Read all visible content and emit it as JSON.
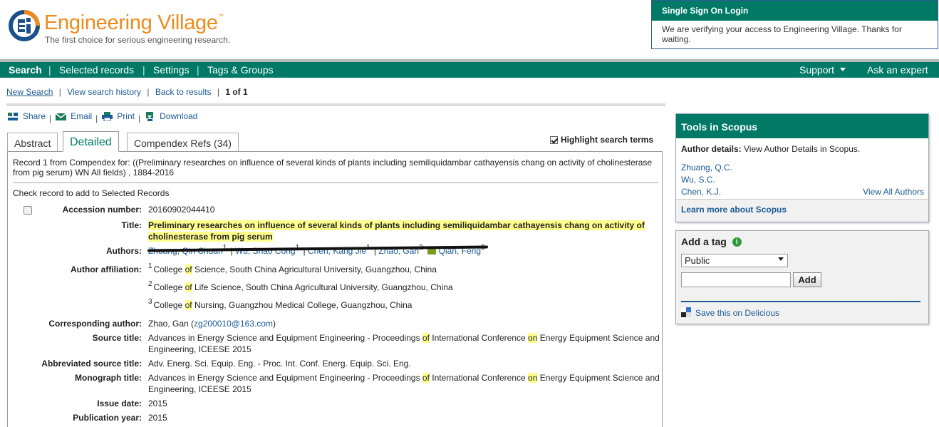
{
  "header": {
    "logo_title": "Engineering Village",
    "logo_tm": "™",
    "tagline": "The first choice for serious engineering research."
  },
  "sso": {
    "title": "Single Sign On Login",
    "message": "We are verifying your access to Engineering Village. Thanks for waiting."
  },
  "nav": {
    "search": "Search",
    "selected": "Selected records",
    "settings": "Settings",
    "tags": "Tags & Groups",
    "support": "Support",
    "ask": "Ask an expert",
    "sep": "|"
  },
  "breadcrumb": {
    "new_search": "New Search",
    "history": "View search history",
    "back": "Back to results",
    "page": "1 of 1",
    "sep": "|"
  },
  "tools": {
    "share": "Share",
    "email": "Email",
    "print": "Print",
    "download": "Download",
    "sep": "|"
  },
  "tabs": {
    "abstract": "Abstract",
    "detailed": "Detailed",
    "refs": "Compendex Refs (34)"
  },
  "highlight_label": "Highlight search terms",
  "record": {
    "from": "Record 1 from Compendex for: ((Preliminary researches on influence of several kinds of plants including semiliquidambar cathayensis chang on activity of cholinesterase from pig serum) WN All fields) , 1884-2016",
    "check_label": "Check record to add to Selected Records",
    "labels": {
      "accession": "Accession number:",
      "title": "Title:",
      "authors": "Authors:",
      "affiliation": "Author affiliation:",
      "corresponding": "Corresponding author:",
      "source": "Source title:",
      "abbrev": "Abbreviated source title:",
      "monograph": "Monograph title:",
      "issue": "Issue date:",
      "year": "Publication year:"
    },
    "accession": "20160902044410",
    "title": "Preliminary researches on influence of several kinds of plants including semiliquidambar cathayensis chang on activity of cholinesterase from pig serum",
    "authors": [
      {
        "name": "Zhuang, Qin Chuan",
        "sup": "1",
        "sep": " | "
      },
      {
        "name": "Wu, Shao Cong",
        "sup": "1",
        "sep": " | "
      },
      {
        "name": "Chen, Kang Jie",
        "sup": "1",
        "sep": " | "
      },
      {
        "name": "Zhao, Gan",
        "sup": "2",
        "sep": ""
      },
      {
        "name": "Qian, Feng",
        "sup": "3",
        "sep": ""
      }
    ],
    "of_word": "of",
    "on_word": "on",
    "affiliations": [
      {
        "num": "1",
        "pre": "College ",
        "post": " Science, South China Agricultural University, Guangzhou, China"
      },
      {
        "num": "2",
        "pre": "College ",
        "post": " Life Science, South China Agricultural University, Guangzhou, China"
      },
      {
        "num": "3",
        "pre": "College ",
        "post": " Nursing, Guangzhou Medical College, Guangzhou, China"
      }
    ],
    "corresponding_name": "Zhao, Gan (",
    "corresponding_email": "zg200010@163.com",
    "corresponding_close": ")",
    "source_a": "Advances in Energy Science and Equipment Engineering - Proceedings ",
    "source_b": " International Conference ",
    "source_c": " Energy Equipment Science and Engineering, ICEESE 2015",
    "abbrev": "Adv. Energ. Sci. Equip. Eng. - Proc. Int. Conf. Energ. Equip. Sci. Eng.",
    "issue_date": "2015",
    "pub_year": "2015"
  },
  "scopus": {
    "title": "Tools in Scopus",
    "details_label": "Author details:",
    "details_text": " View Author Details in Scopus.",
    "authors": [
      "Zhuang, Q.C.",
      "Wu, S.C.",
      "Chen, K.J."
    ],
    "view_all": "View All Authors",
    "learn": "Learn more about Scopus"
  },
  "tag": {
    "title": "Add a tag",
    "info": "i",
    "visibility": "Public",
    "input_value": "",
    "add": "Add",
    "delicious": "Save this on Delicious"
  },
  "colors": {
    "brand_green": "#007a66",
    "logo_orange": "#f08a1c",
    "link_blue": "#1a5a96",
    "highlight": "#ffff8c"
  }
}
